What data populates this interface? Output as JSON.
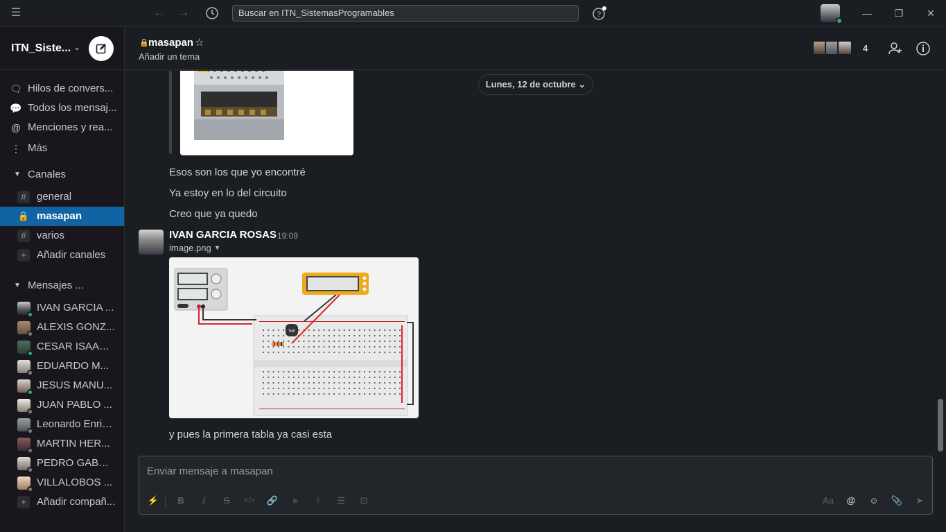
{
  "topbar": {
    "search_text": "Buscar en ITN_SistemasProgramables",
    "icons": [
      "menu-icon",
      "back-icon",
      "forward-icon",
      "history-icon",
      "help-icon",
      "minimize-icon",
      "restore-icon",
      "close-icon"
    ]
  },
  "workspace": {
    "name": "ITN_Siste..."
  },
  "nav": {
    "threads": "Hilos de convers...",
    "all_dms": "Todos los mensaj...",
    "mentions": "Menciones y rea...",
    "more": "Más"
  },
  "channels": {
    "header": "Canales",
    "items": [
      {
        "name": "general"
      },
      {
        "name": "masapan"
      },
      {
        "name": "varios"
      }
    ],
    "add": "Añadir canales"
  },
  "dms": {
    "header": "Mensajes ...",
    "items": [
      {
        "name": "IVAN GARCIA ...",
        "online": true
      },
      {
        "name": "ALEXIS GONZ...",
        "online": false
      },
      {
        "name": "CESAR ISAAC ...",
        "online": true
      },
      {
        "name": "EDUARDO M...",
        "online": false
      },
      {
        "name": "JESUS MANU...",
        "online": true
      },
      {
        "name": "JUAN PABLO ...",
        "online": false
      },
      {
        "name": "Leonardo Enriq...",
        "online": false
      },
      {
        "name": "MARTIN HER...",
        "online": false
      },
      {
        "name": "PEDRO GABRI...",
        "online": false
      },
      {
        "name": "VILLALOBOS ...",
        "online": false
      }
    ],
    "add": "Añadir compañ..."
  },
  "channel_header": {
    "name": "masapan",
    "topic": "Añadir un tema",
    "member_count": "4"
  },
  "messages": {
    "date_divider": "Lunes, 12 de octubre",
    "lines": [
      "Esos son los que yo encontré",
      "Ya estoy en lo del circuito",
      "Creo que ya quedo"
    ],
    "author": "IVAN GARCIA ROSAS",
    "time": "19:09",
    "file_name": "image.png",
    "last_line": "y pues la primera tabla ya casi esta"
  },
  "composer": {
    "placeholder": "Enviar mensaje a masapan",
    "text_format_label": "Aa"
  },
  "colors": {
    "active_channel": "#1164a3",
    "online": "#2bac76"
  }
}
